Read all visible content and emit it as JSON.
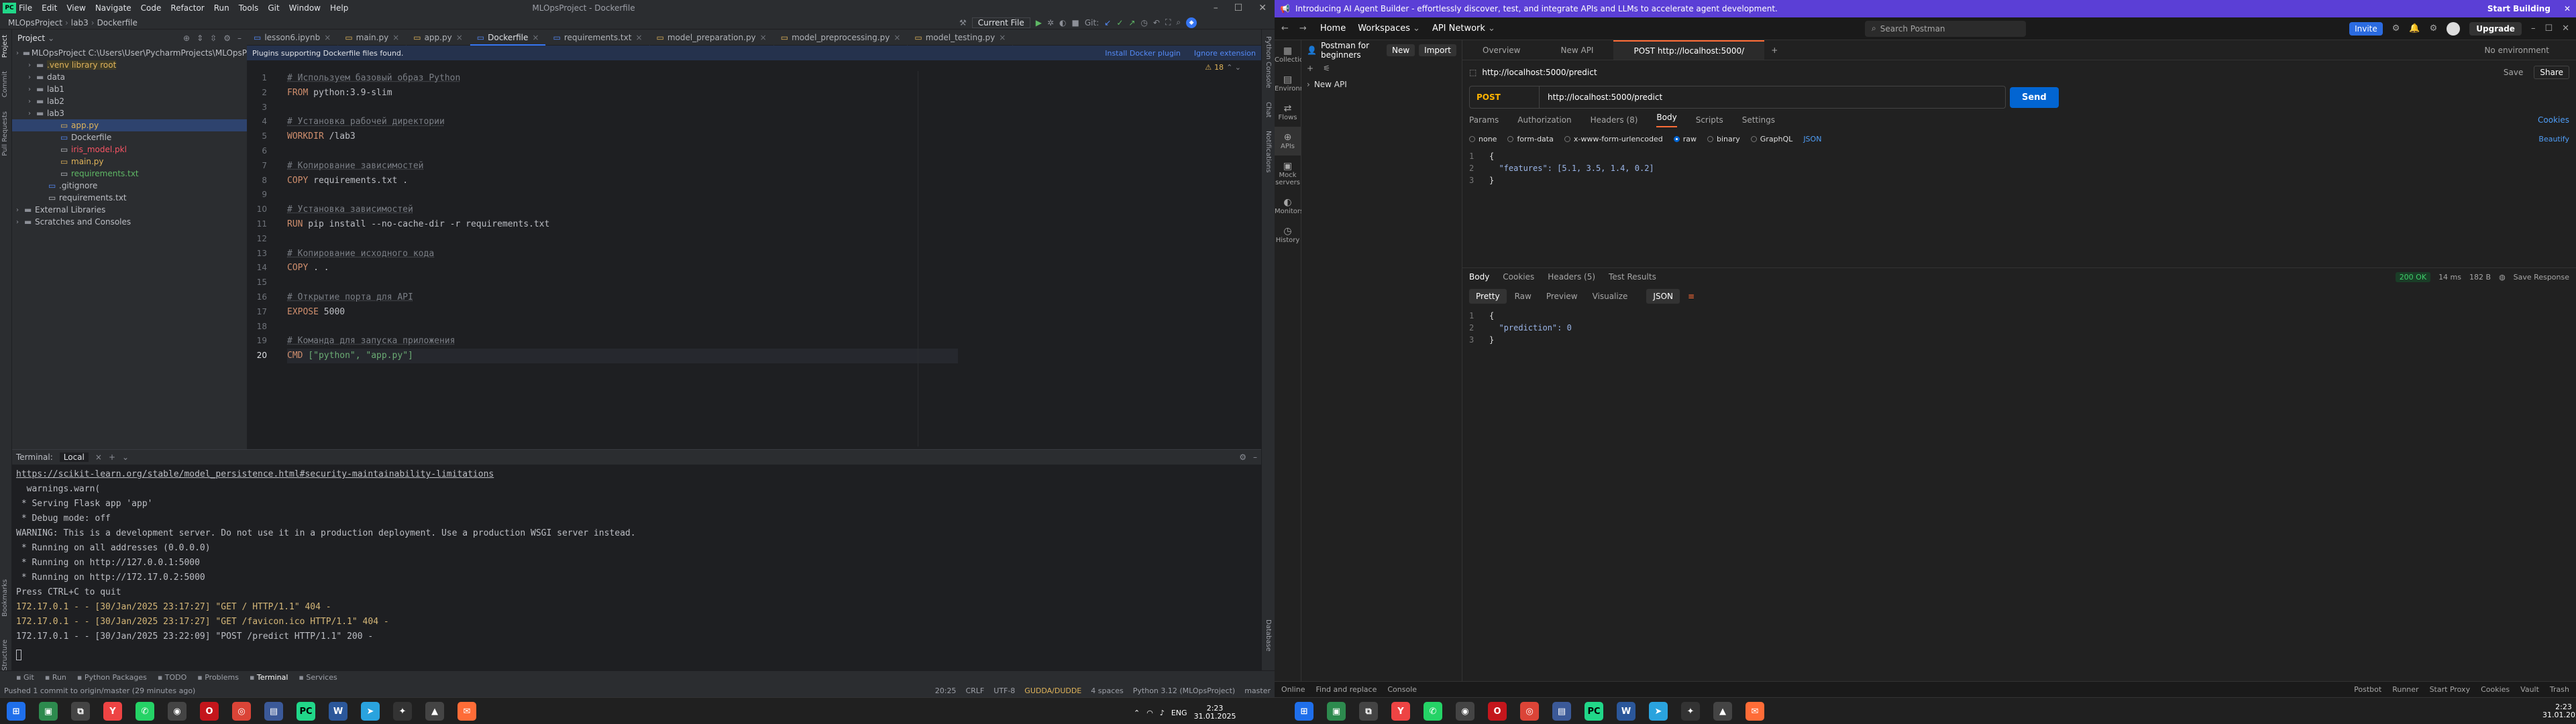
{
  "ide": {
    "menu": [
      "File",
      "Edit",
      "View",
      "Navigate",
      "Code",
      "Refactor",
      "Run",
      "Tools",
      "Git",
      "Window",
      "Help"
    ],
    "title": "MLOpsProject - Dockerfile",
    "breadcrumb": [
      "MLOpsProject",
      "lab3",
      "Dockerfile"
    ],
    "config": "Current File",
    "project_label": "Project",
    "tree": [
      {
        "label": "MLOpsProject  C:\\Users\\User\\PycharmProjects\\MLOpsP",
        "depth": 0,
        "type": "folder"
      },
      {
        "label": ".venv  library root",
        "depth": 1,
        "type": "folder",
        "hl": true
      },
      {
        "label": "data",
        "depth": 1,
        "type": "folder"
      },
      {
        "label": "lab1",
        "depth": 1,
        "type": "folder"
      },
      {
        "label": "lab2",
        "depth": 1,
        "type": "folder"
      },
      {
        "label": "lab3",
        "depth": 1,
        "type": "folder"
      },
      {
        "label": "app.py",
        "depth": 3,
        "type": "py",
        "sel": true
      },
      {
        "label": "Dockerfile",
        "depth": 3,
        "type": "file"
      },
      {
        "label": "iris_model.pkl",
        "depth": 3,
        "type": "pkl"
      },
      {
        "label": "main.py",
        "depth": 3,
        "type": "py"
      },
      {
        "label": "requirements.txt",
        "depth": 3,
        "type": "txt"
      },
      {
        "label": ".gitignore",
        "depth": 2,
        "type": "file"
      },
      {
        "label": "requirements.txt",
        "depth": 2,
        "type": "txt"
      },
      {
        "label": "External Libraries",
        "depth": 0,
        "type": "lib"
      },
      {
        "label": "Scratches and Consoles",
        "depth": 0,
        "type": "lib"
      }
    ],
    "tabs": [
      "lesson6.ipynb",
      "main.py",
      "app.py",
      "Dockerfile",
      "requirements.txt",
      "model_preparation.py",
      "model_preprocessing.py",
      "model_testing.py"
    ],
    "active_tab": "Dockerfile",
    "plugin_banner": "Plugins supporting Dockerfile files found.",
    "plugin_install": "Install Docker plugin",
    "plugin_ignore": "Ignore extension",
    "warnings": "18",
    "code": [
      {
        "n": "1",
        "t": "# Используем базовый образ Python",
        "k": "c"
      },
      {
        "n": "2",
        "t": "FROM python:3.9-slim",
        "k": "i"
      },
      {
        "n": "3",
        "t": "",
        "k": "p"
      },
      {
        "n": "4",
        "t": "# Установка рабочей директории",
        "k": "c"
      },
      {
        "n": "5",
        "t": "WORKDIR /lab3",
        "k": "i"
      },
      {
        "n": "6",
        "t": "",
        "k": "p"
      },
      {
        "n": "7",
        "t": "# Копирование зависимостей",
        "k": "c"
      },
      {
        "n": "8",
        "t": "COPY requirements.txt .",
        "k": "i"
      },
      {
        "n": "9",
        "t": "",
        "k": "p"
      },
      {
        "n": "10",
        "t": "# Установка зависимостей",
        "k": "c"
      },
      {
        "n": "11",
        "t": "RUN pip install --no-cache-dir -r requirements.txt",
        "k": "i"
      },
      {
        "n": "12",
        "t": "",
        "k": "p"
      },
      {
        "n": "13",
        "t": "# Копирование исходного кода",
        "k": "c"
      },
      {
        "n": "14",
        "t": "COPY . .",
        "k": "i"
      },
      {
        "n": "15",
        "t": "",
        "k": "p"
      },
      {
        "n": "16",
        "t": "# Открытие порта для API",
        "k": "c"
      },
      {
        "n": "17",
        "t": "EXPOSE 5000",
        "k": "i"
      },
      {
        "n": "18",
        "t": "",
        "k": "p"
      },
      {
        "n": "19",
        "t": "# Команда для запуска приложения",
        "k": "c"
      },
      {
        "n": "20",
        "t": "CMD [\"python\", \"app.py\"]",
        "k": "i"
      }
    ],
    "terminal": {
      "label": "Terminal:",
      "tab": "Local",
      "lines": [
        {
          "t": "https://scikit-learn.org/stable/model_persistence.html#security-maintainability-limitations",
          "c": "lnk"
        },
        {
          "t": "  warnings.warn(",
          "c": ""
        },
        {
          "t": " * Serving Flask app 'app'",
          "c": ""
        },
        {
          "t": " * Debug mode: off",
          "c": ""
        },
        {
          "t": "WARNING: This is a development server. Do not use it in a production deployment. Use a production WSGI server instead.",
          "c": "red"
        },
        {
          "t": " * Running on all addresses (0.0.0.0)",
          "c": ""
        },
        {
          "t": " * Running on http://127.0.0.1:5000",
          "c": "mix"
        },
        {
          "t": " * Running on http://172.17.0.2:5000",
          "c": "mix"
        },
        {
          "t": "Press CTRL+C to quit",
          "c": "grn"
        },
        {
          "t": "172.17.0.1 - - [30/Jan/2025 23:17:27] \"GET / HTTP/1.1\" 404 -",
          "c": "y"
        },
        {
          "t": "172.17.0.1 - - [30/Jan/2025 23:17:27] \"GET /favicon.ico HTTP/1.1\" 404 -",
          "c": "y"
        },
        {
          "t": "172.17.0.1 - - [30/Jan/2025 23:22:09] \"POST /predict HTTP/1.1\" 200 -",
          "c": ""
        }
      ]
    },
    "bottom_tabs": [
      "Git",
      "Run",
      "Python Packages",
      "TODO",
      "Problems",
      "Terminal",
      "Services"
    ],
    "status_msg": "Pushed 1 commit to origin/master (29 minutes ago)",
    "status_right": [
      "20:25",
      "CRLF",
      "UTF-8",
      "GUDDA/DUDDE",
      "4 spaces",
      "Python 3.12 (MLOpsProject)",
      "master"
    ]
  },
  "pm": {
    "banner": "Introducing AI Agent Builder - effortlessly discover, test, and integrate APIs and LLMs to accelerate agent development.",
    "banner_link": "Start Building",
    "nav": [
      "Home",
      "Workspaces",
      "API Network"
    ],
    "search": "Search Postman",
    "invite": "Invite",
    "upgrade": "Upgrade",
    "workspace": "Postman for beginners",
    "new": "New",
    "import": "Import",
    "sidebar": [
      "Collections",
      "Environments",
      "Flows",
      "APIs",
      "Mock servers",
      "Monitors",
      "History"
    ],
    "api_item": "New API",
    "tabs": [
      "Overview",
      "New API",
      "POST http://localhost:5000/"
    ],
    "env": "No environment",
    "req_title": "http://localhost:5000/predict",
    "save": "Save",
    "share": "Share",
    "method": "POST",
    "url": "http://localhost:5000/predict",
    "send": "Send",
    "req_tabs": [
      "Params",
      "Authorization",
      "Headers (8)",
      "Body",
      "Scripts",
      "Settings"
    ],
    "cookies": "Cookies",
    "beautify": "Beautify",
    "body_types": [
      "none",
      "form-data",
      "x-www-form-urlencoded",
      "raw",
      "binary",
      "GraphQL"
    ],
    "body_fmt": "JSON",
    "body": [
      {
        "n": "1",
        "t": "{"
      },
      {
        "n": "2",
        "t": "  \"features\": [5.1, 3.5, 1.4, 0.2]"
      },
      {
        "n": "3",
        "t": "}"
      }
    ],
    "resp_tabs": [
      "Body",
      "Cookies",
      "Headers (5)",
      "Test Results"
    ],
    "status": "200 OK",
    "time": "14 ms",
    "size": "182 B",
    "save_resp": "Save Response",
    "view_tabs": [
      "Pretty",
      "Raw",
      "Preview",
      "Visualize"
    ],
    "resp_fmt": "JSON",
    "resp": [
      {
        "n": "1",
        "t": "{"
      },
      {
        "n": "2",
        "t": "  \"prediction\": 0"
      },
      {
        "n": "3",
        "t": "}"
      }
    ],
    "status_left": [
      "Online",
      "Find and replace",
      "Console"
    ],
    "status_right": [
      "Postbot",
      "Runner",
      "Start Proxy",
      "Cookies",
      "Vault",
      "Trash"
    ]
  },
  "taskbar": {
    "lang": "ENG",
    "time": "2:23",
    "date": "31.01.2025"
  }
}
